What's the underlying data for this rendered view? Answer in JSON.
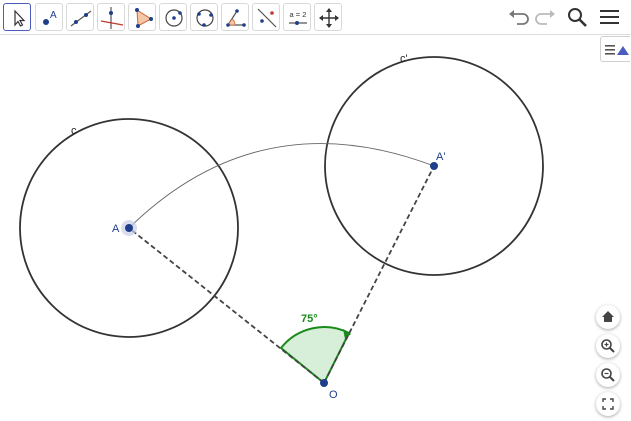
{
  "toolbar": {
    "tools": [
      {
        "name": "move-tool",
        "icon": "cursor-arrow-icon"
      },
      {
        "name": "point-tool",
        "icon": "point-a-icon",
        "letter": "A"
      },
      {
        "name": "line-tool",
        "icon": "line-through-points-icon"
      },
      {
        "name": "perpendicular-line-tool",
        "icon": "perpendicular-icon"
      },
      {
        "name": "polygon-tool",
        "icon": "triangle-icon"
      },
      {
        "name": "circle-center-point-tool",
        "icon": "circle-center-icon"
      },
      {
        "name": "circle-three-points-tool",
        "icon": "circle-three-points-icon"
      },
      {
        "name": "angle-tool",
        "icon": "angle-icon"
      },
      {
        "name": "reflect-tool",
        "icon": "reflect-line-icon"
      },
      {
        "name": "slider-tool",
        "icon": "slider-icon",
        "text": "a = 2"
      },
      {
        "name": "move-view-tool",
        "icon": "four-arrows-icon"
      }
    ],
    "right": [
      "undo-icon",
      "redo-icon",
      "search-icon",
      "menu-icon"
    ]
  },
  "canvas": {
    "labels": {
      "circle_c": "c",
      "circle_c_prime": "c'",
      "point_a": "A",
      "point_a_prime": "A'",
      "point_o": "O",
      "angle": "75°"
    },
    "colors": {
      "point": "#1f3f8a",
      "angle": "#1a8a1a",
      "angle_fill": "#d7efd9",
      "circle": "#333333"
    }
  },
  "zoom_controls": [
    "home-icon",
    "zoom-in-icon",
    "zoom-out-icon",
    "fullscreen-icon"
  ]
}
